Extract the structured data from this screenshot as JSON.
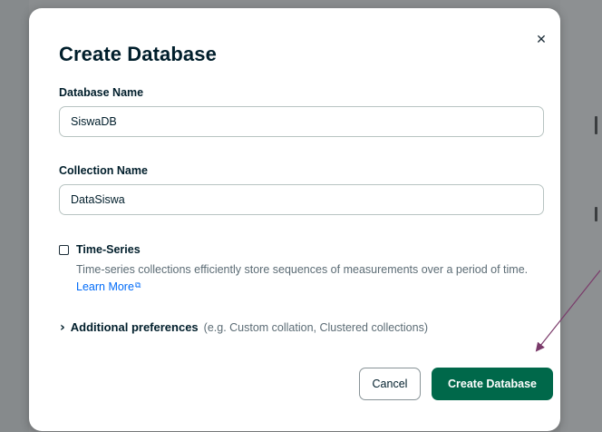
{
  "modal": {
    "title": "Create Database",
    "close_icon": "close-icon",
    "database_name": {
      "label": "Database Name",
      "value": "SiswaDB"
    },
    "collection_name": {
      "label": "Collection Name",
      "value": "DataSiswa"
    },
    "time_series": {
      "label": "Time-Series",
      "checked": false,
      "description": "Time-series collections efficiently store sequences of measurements over a period of time.",
      "learn_more": "Learn More",
      "learn_more_icon": "external-link-icon"
    },
    "additional_preferences": {
      "label": "Additional preferences",
      "hint": "(e.g. Custom collation, Clustered collections)",
      "icon": "chevron-right-icon"
    },
    "buttons": {
      "cancel": "Cancel",
      "create": "Create Database"
    }
  },
  "annotation": {
    "type": "arrow",
    "color": "#7a3a6a",
    "points_to": "create-database-button"
  },
  "colors": {
    "primary_button": "#00684a",
    "link": "#016bf8",
    "title_text": "#001e2b",
    "muted_text": "#5c6c75",
    "overlay": "#8a8d8f"
  }
}
